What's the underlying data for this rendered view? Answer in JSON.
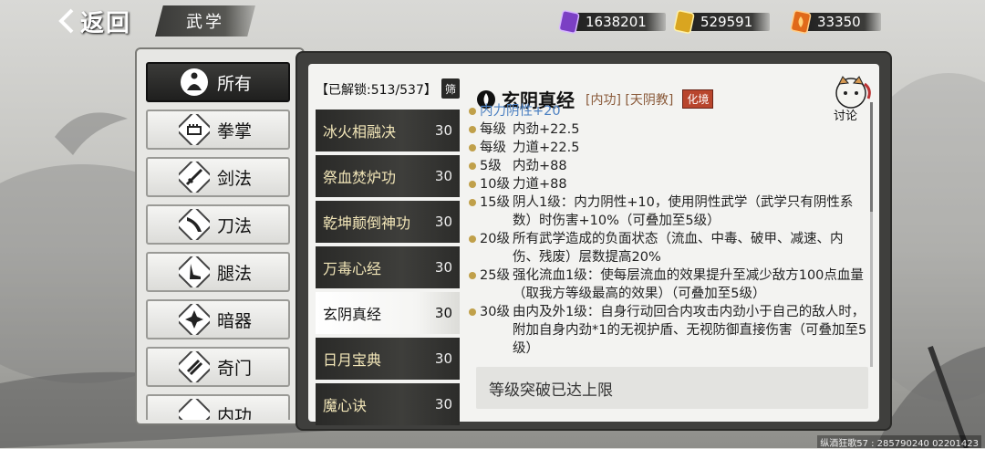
{
  "topbar": {
    "back_label": "返回",
    "title": "武学"
  },
  "currencies": [
    {
      "icon": "purple-crystal-icon",
      "value": "1638201"
    },
    {
      "icon": "gold-token-icon",
      "value": "529591"
    },
    {
      "icon": "orange-flame-icon",
      "value": "33350"
    }
  ],
  "categories": [
    {
      "label": "所有",
      "icon": "meditation-icon",
      "active": true
    },
    {
      "label": "拳掌",
      "icon": "fist-icon",
      "active": false
    },
    {
      "label": "剑法",
      "icon": "sword-icon",
      "active": false
    },
    {
      "label": "刀法",
      "icon": "blade-icon",
      "active": false
    },
    {
      "label": "腿法",
      "icon": "kick-icon",
      "active": false
    },
    {
      "label": "暗器",
      "icon": "shuriken-icon",
      "active": false
    },
    {
      "label": "奇门",
      "icon": "scroll-weapon-icon",
      "active": false
    },
    {
      "label": "内功",
      "icon": "inner-power-icon",
      "active": false
    }
  ],
  "unlock": {
    "label": "【已解锁:513/537】",
    "filter": "筛"
  },
  "skills": [
    {
      "name": "冰火相融决",
      "level": "30",
      "active": false
    },
    {
      "name": "祭血焚炉功",
      "level": "30",
      "active": false
    },
    {
      "name": "乾坤颠倒神功",
      "level": "30",
      "active": false
    },
    {
      "name": "万毒心经",
      "level": "30",
      "active": false
    },
    {
      "name": "玄阴真经",
      "level": "30",
      "active": true
    },
    {
      "name": "日月宝典",
      "level": "30",
      "active": false
    },
    {
      "name": "魔心诀",
      "level": "30",
      "active": false
    }
  ],
  "detail": {
    "name": "玄阴真经",
    "tags": "[内功] [天阴教]",
    "rank": "化境",
    "discuss": "讨论",
    "effects": [
      {
        "lv": "",
        "text": "内力阴性+20",
        "blue": true
      },
      {
        "lv": "每级",
        "text": "内劲+22.5"
      },
      {
        "lv": "每级",
        "text": "力道+22.5"
      },
      {
        "lv": "5级",
        "text": "内劲+88"
      },
      {
        "lv": "10级",
        "text": "力道+88"
      },
      {
        "lv": "15级",
        "text": "阴人1级：内力阴性+10，使用阴性武学（武学只有阴性系数）时伤害+10%（可叠加至5级）"
      },
      {
        "lv": "20级",
        "text": "所有武学造成的负面状态（流血、中毒、破甲、减速、内伤、残废）层数提高20%"
      },
      {
        "lv": "25级",
        "text": "强化流血1级：使每层流血的效果提升至减少敌方100点血量（取我方等级最高的效果）（可叠加至5级）"
      },
      {
        "lv": "30级",
        "text": "由内及外1级：自身行动回合内攻击内劲小于自己的敌人时，附加自身内劲*1的无视护盾、无视防御直接伤害（可叠加至5级）"
      }
    ],
    "limit": "等级突破已达上限"
  },
  "watermark": "纵酒狂歌57 : 285790240  02201423"
}
